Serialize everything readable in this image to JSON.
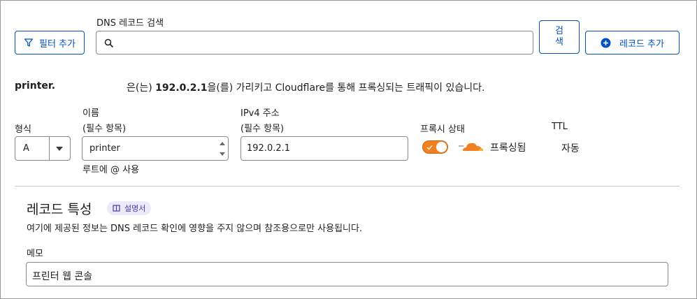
{
  "toolbar": {
    "filter_button": "필터 추가",
    "search_label": "DNS 레코드 검색",
    "search_value": "",
    "search_button": "검\n색",
    "add_record_button": "레코드 추가"
  },
  "summary": {
    "name": "printer.",
    "prefix": "은(는) ",
    "ip": "192.0.2.1",
    "suffix": "을(를) 가리키고 Cloudflare를 통해 프록싱되는 트래픽이 있습니다."
  },
  "form": {
    "type_label": "형식",
    "type_value": "A",
    "name_label_line1": "이름",
    "name_label_line2": "(필수 항목)",
    "name_value": "printer",
    "name_hint": "루트에 @ 사용",
    "ipv4_label_line1": "IPv4 주소",
    "ipv4_label_line2": "(필수 항목)",
    "ipv4_value": "192.0.2.1",
    "proxy_label": "프록시 상태",
    "proxy_status": "프록싱됨",
    "proxy_enabled": true,
    "ttl_label": "TTL",
    "ttl_value": "자동"
  },
  "attributes": {
    "title": "레코드 특성",
    "docs_badge": "설명서",
    "description": "여기에 제공된 정보는 DNS 레코드 확인에 영향을 주지 않으며 참조용으로만 사용됩니다.",
    "memo_label": "메모",
    "memo_value": "프린터 웹 콘솔"
  },
  "colors": {
    "accent": "#0051c3",
    "proxy_orange": "#f38020",
    "badge_bg": "#ece9fb",
    "badge_text": "#4a3aa8"
  }
}
